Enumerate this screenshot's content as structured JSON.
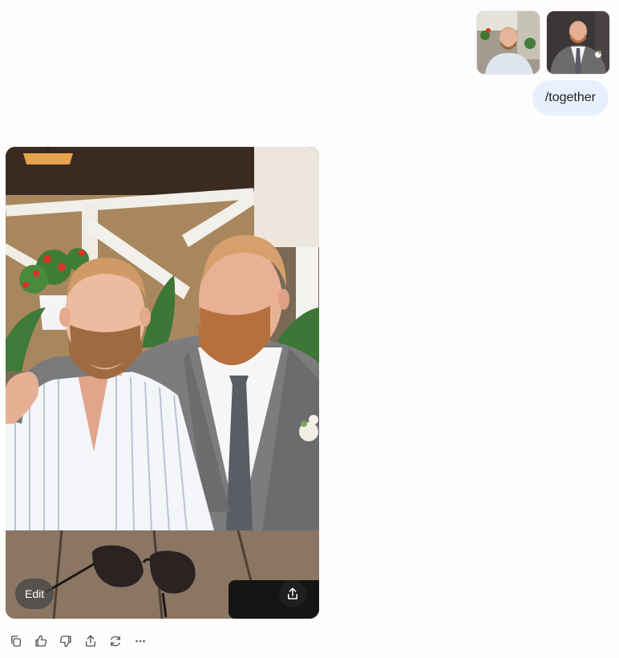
{
  "attachments": [
    {
      "name": "photo-man-striped-shirt"
    },
    {
      "name": "photo-man-grey-suit"
    }
  ],
  "user_message": {
    "text": "/together"
  },
  "generated_image": {
    "alt": "",
    "edit_label": "Edit",
    "share_icon": "share-up-icon"
  },
  "actions": [
    {
      "name": "copy-icon"
    },
    {
      "name": "thumbs-up-icon"
    },
    {
      "name": "thumbs-down-icon"
    },
    {
      "name": "share-icon"
    },
    {
      "name": "regenerate-icon"
    },
    {
      "name": "more-icon"
    }
  ],
  "colors": {
    "user_bubble": "#e8f0fe",
    "icon_gray": "#555555",
    "edit_bg": "#464646"
  }
}
